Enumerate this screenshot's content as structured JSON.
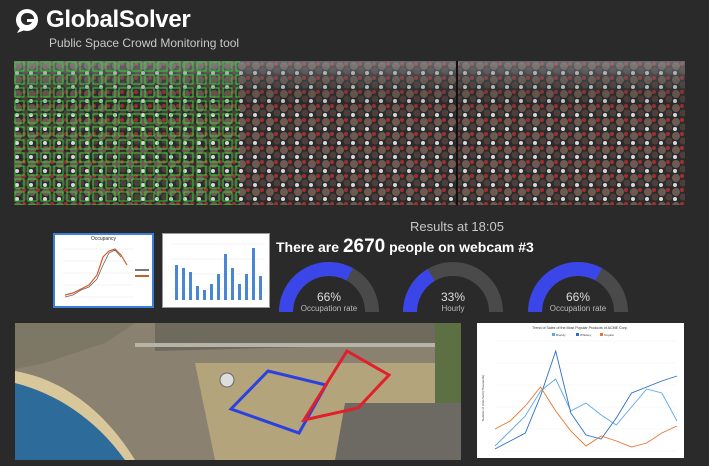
{
  "header": {
    "brand": "GlobalSolver",
    "subtitle": "Public Space Crowd Monitoring tool",
    "logo_icon": "speech-bubble-logo-icon"
  },
  "results": {
    "title": "Results at 18:05",
    "prefix": "There are",
    "count": "2670",
    "middle": "people",
    "suffix": "on webcam #3"
  },
  "thumbnails": {
    "occupancy_title": "Occupancy"
  },
  "gauges": [
    {
      "value": "66%",
      "label": "Occupation rate",
      "fraction": 0.66
    },
    {
      "value": "33%",
      "label": "Hourly",
      "fraction": 0.33
    },
    {
      "value": "66%",
      "label": "Occupation rate",
      "fraction": 0.66
    }
  ],
  "colors": {
    "gauge_fill": "#3a46e8",
    "gauge_track": "#4a4a4a",
    "detect_green": "#36d836",
    "zone_blue": "#2b40e0",
    "zone_red": "#e0202a"
  },
  "chart_data": {
    "type": "line",
    "title": "Trend of Sales of the Most Popular Products of ACME Corp.",
    "ylabel": "Number of Units Sold (Thousands)",
    "series": [
      {
        "name": "Brandy",
        "color": "#5aa9e6",
        "values": [
          5,
          20,
          35,
          60,
          72,
          40,
          48,
          36,
          26,
          44,
          62,
          58,
          30
        ]
      },
      {
        "name": "Whiskey",
        "color": "#2d6fc4",
        "values": [
          2,
          10,
          18,
          55,
          100,
          38,
          16,
          12,
          33,
          58,
          64,
          70,
          75
        ]
      },
      {
        "name": "Tequila",
        "color": "#e9752d",
        "values": [
          22,
          30,
          45,
          64,
          40,
          20,
          5,
          15,
          10,
          4,
          8,
          18,
          25
        ]
      }
    ]
  }
}
